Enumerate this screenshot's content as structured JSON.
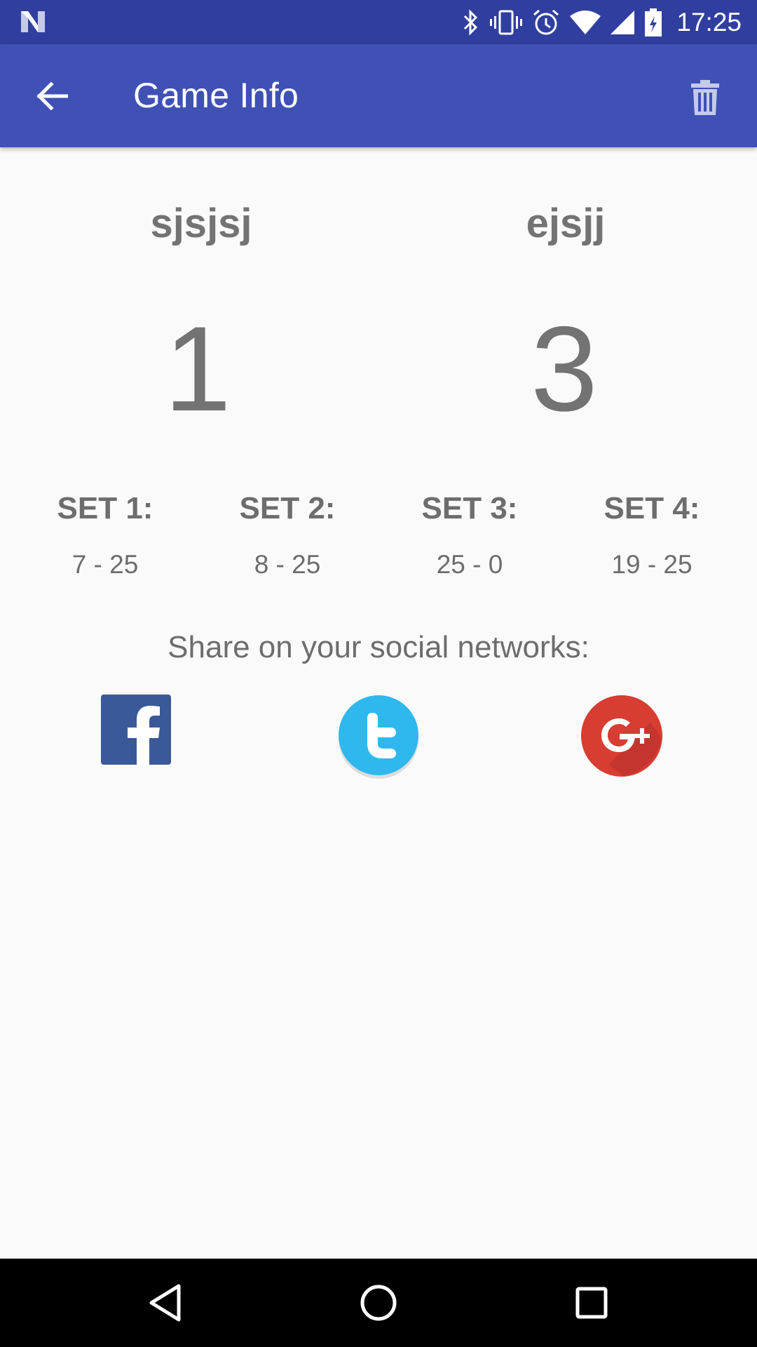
{
  "status_bar": {
    "time": "17:25",
    "icons": [
      "notification-n-icon",
      "bluetooth-icon",
      "vibrate-icon",
      "alarm-icon",
      "wifi-icon",
      "signal-icon",
      "battery-charging-icon"
    ]
  },
  "app_bar": {
    "title": "Game Info",
    "back_icon": "arrow-back-icon",
    "delete_icon": "trash-icon"
  },
  "game": {
    "team_left": "sjsjsj",
    "team_right": "ejsjj",
    "score_left": "1",
    "score_right": "3",
    "sets": [
      {
        "label": "SET 1:",
        "score": "7 - 25"
      },
      {
        "label": "SET 2:",
        "score": "8 - 25"
      },
      {
        "label": "SET 3:",
        "score": "25 - 0"
      },
      {
        "label": "SET 4:",
        "score": "19 - 25"
      }
    ]
  },
  "share": {
    "label": "Share on your social networks:",
    "networks": [
      "facebook-icon",
      "twitter-icon",
      "google-plus-icon"
    ]
  },
  "colors": {
    "status_bar": "#303f9f",
    "app_bar": "#3f51b5",
    "text_gray": "#737373",
    "facebook": "#3b5998",
    "twitter": "#2fb8ee",
    "google_plus": "#d73d32"
  },
  "nav_bar": {
    "icons": [
      "nav-back-icon",
      "nav-home-icon",
      "nav-recents-icon"
    ]
  }
}
